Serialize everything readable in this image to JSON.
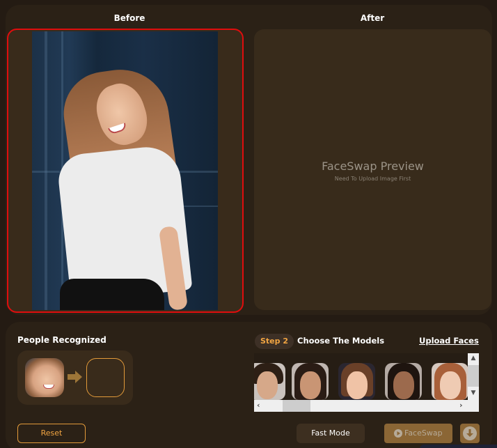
{
  "header": {
    "before_label": "Before",
    "after_label": "After"
  },
  "preview": {
    "title": "FaceSwap Preview",
    "subtitle": "Need To Upload Image First"
  },
  "people": {
    "title": "People Recognized",
    "arrow_icon": "arrow-right-icon"
  },
  "models": {
    "step_badge": "Step 2",
    "title": "Choose The Models",
    "upload_link": "Upload Faces",
    "items": [
      {
        "name": "model-1",
        "desc": "man with short dark hair"
      },
      {
        "name": "model-2",
        "desc": "woman with long dark hair"
      },
      {
        "name": "model-3",
        "desc": "woman with brown bangs"
      },
      {
        "name": "model-4",
        "desc": "woman with dark curly hair"
      },
      {
        "name": "model-5",
        "desc": "woman with auburn hair"
      }
    ],
    "scroll_up": "▲",
    "scroll_down": "▼",
    "scroll_left": "‹",
    "scroll_right": "›"
  },
  "buttons": {
    "reset": "Reset",
    "fast_mode": "Fast Mode",
    "faceswap": "FaceSwap",
    "download_icon": "download-icon"
  },
  "colors": {
    "accent": "#e39b3a",
    "selected_border": "#e00d0d",
    "panel_bg": "#2b2116",
    "button_disabled": "#8b6635"
  }
}
